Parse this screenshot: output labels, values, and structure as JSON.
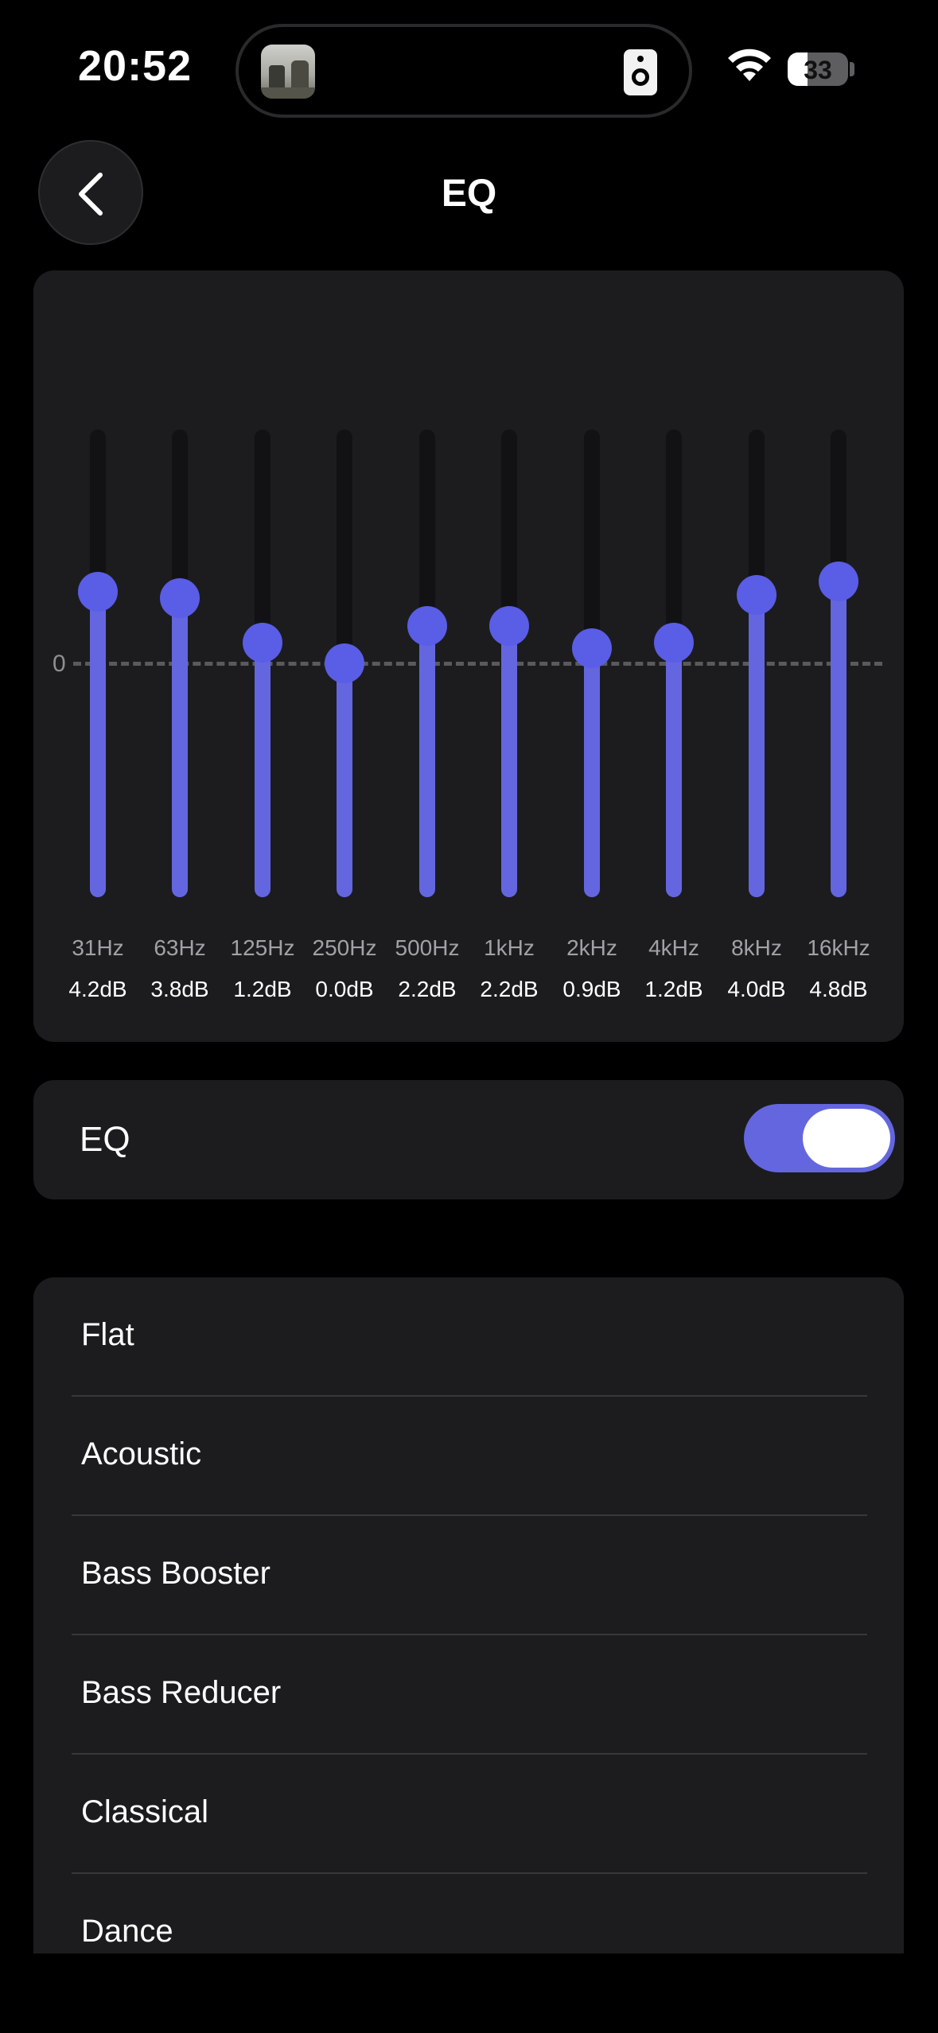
{
  "status": {
    "time": "20:52",
    "battery_percent": "33",
    "wifi_icon": "wifi-icon",
    "live_activity_icon": "speaker-icon"
  },
  "header": {
    "title": "EQ",
    "back_icon": "chevron-left-icon"
  },
  "eq": {
    "zero_label": "0",
    "range_db": [
      -12,
      12
    ],
    "accent_color": "#6466e0",
    "bands": [
      {
        "freq": "31Hz",
        "db_label": "4.2dB",
        "gain": 4.2
      },
      {
        "freq": "63Hz",
        "db_label": "3.8dB",
        "gain": 3.8
      },
      {
        "freq": "125Hz",
        "db_label": "1.2dB",
        "gain": 1.2
      },
      {
        "freq": "250Hz",
        "db_label": "0.0dB",
        "gain": 0.0
      },
      {
        "freq": "500Hz",
        "db_label": "2.2dB",
        "gain": 2.2
      },
      {
        "freq": "1kHz",
        "db_label": "2.2dB",
        "gain": 2.2
      },
      {
        "freq": "2kHz",
        "db_label": "0.9dB",
        "gain": 0.9
      },
      {
        "freq": "4kHz",
        "db_label": "1.2dB",
        "gain": 1.2
      },
      {
        "freq": "8kHz",
        "db_label": "4.0dB",
        "gain": 4.0
      },
      {
        "freq": "16kHz",
        "db_label": "4.8dB",
        "gain": 4.8
      }
    ]
  },
  "eq_toggle": {
    "label": "EQ",
    "enabled": true
  },
  "presets": [
    {
      "label": "Flat"
    },
    {
      "label": "Acoustic"
    },
    {
      "label": "Bass Booster"
    },
    {
      "label": "Bass Reducer"
    },
    {
      "label": "Classical"
    },
    {
      "label": "Dance"
    }
  ]
}
